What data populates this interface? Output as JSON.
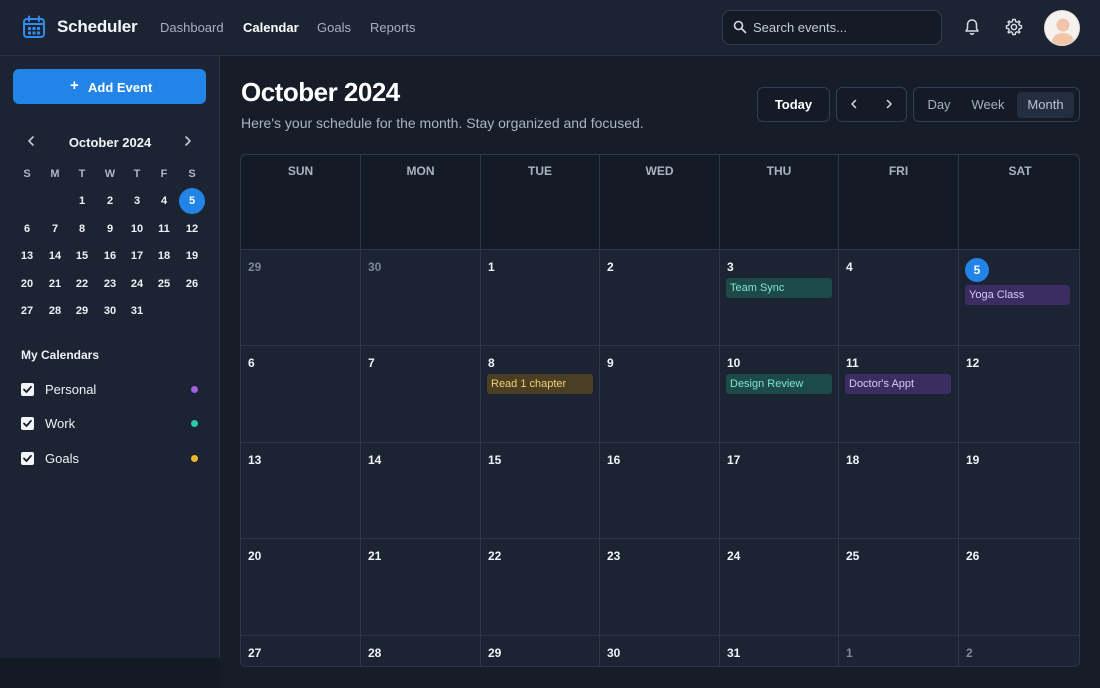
{
  "header": {
    "app_title": "Scheduler",
    "nav": [
      {
        "label": "Dashboard",
        "active": false
      },
      {
        "label": "Calendar",
        "active": true
      },
      {
        "label": "Goals",
        "active": false
      },
      {
        "label": "Reports",
        "active": false
      }
    ],
    "search_placeholder": "Search events...",
    "icons": [
      "calendar-icon",
      "search-icon",
      "bell-icon",
      "gear-icon",
      "avatar"
    ]
  },
  "sidebar": {
    "add_event_label": "Add Event",
    "mini_calendar": {
      "title": "October 2024",
      "weekdays": [
        "S",
        "M",
        "T",
        "W",
        "T",
        "F",
        "S"
      ],
      "weeks": [
        [
          "",
          "",
          "1",
          "2",
          "3",
          "4",
          "5"
        ],
        [
          "6",
          "7",
          "8",
          "9",
          "10",
          "11",
          "12"
        ],
        [
          "13",
          "14",
          "15",
          "16",
          "17",
          "18",
          "19"
        ],
        [
          "20",
          "21",
          "22",
          "23",
          "24",
          "25",
          "26"
        ],
        [
          "27",
          "28",
          "29",
          "30",
          "31",
          "",
          ""
        ]
      ],
      "today": "5"
    },
    "my_calendars_title": "My Calendars",
    "calendars": [
      {
        "label": "Personal",
        "checked": true,
        "color": "#a060e0"
      },
      {
        "label": "Work",
        "checked": true,
        "color": "#2cc9a8"
      },
      {
        "label": "Goals",
        "checked": true,
        "color": "#f0b429"
      }
    ]
  },
  "main": {
    "title": "October 2024",
    "subtitle": "Here's your schedule for the month. Stay organized and focused.",
    "today_label": "Today",
    "views": [
      {
        "label": "Day",
        "active": false
      },
      {
        "label": "Week",
        "active": false
      },
      {
        "label": "Month",
        "active": true
      }
    ],
    "weekdays": [
      "SUN",
      "MON",
      "TUE",
      "WED",
      "THU",
      "FRI",
      "SAT"
    ],
    "weeks": [
      [
        {
          "day": "29",
          "other": true
        },
        {
          "day": "30",
          "other": true
        },
        {
          "day": "1"
        },
        {
          "day": "2"
        },
        {
          "day": "3",
          "event": {
            "label": "Team Sync",
            "type": "work"
          }
        },
        {
          "day": "4"
        },
        {
          "day": "5",
          "today": true,
          "event": {
            "label": "Yoga Class",
            "type": "personal"
          }
        }
      ],
      [
        {
          "day": "6"
        },
        {
          "day": "7"
        },
        {
          "day": "8",
          "event": {
            "label": "Read 1 chapter",
            "type": "goal"
          }
        },
        {
          "day": "9"
        },
        {
          "day": "10",
          "event": {
            "label": "Design Review",
            "type": "work"
          }
        },
        {
          "day": "11",
          "event": {
            "label": "Doctor's Appt",
            "type": "personal"
          }
        },
        {
          "day": "12"
        }
      ],
      [
        {
          "day": "13"
        },
        {
          "day": "14"
        },
        {
          "day": "15"
        },
        {
          "day": "16"
        },
        {
          "day": "17"
        },
        {
          "day": "18"
        },
        {
          "day": "19"
        }
      ],
      [
        {
          "day": "20"
        },
        {
          "day": "21"
        },
        {
          "day": "22"
        },
        {
          "day": "23"
        },
        {
          "day": "24"
        },
        {
          "day": "25"
        },
        {
          "day": "26"
        }
      ],
      [
        {
          "day": "27"
        },
        {
          "day": "28"
        },
        {
          "day": "29"
        },
        {
          "day": "30"
        },
        {
          "day": "31"
        },
        {
          "day": "1",
          "other": true
        },
        {
          "day": "2",
          "other": true
        }
      ]
    ],
    "event_colors": {
      "work": {
        "bg": "#1d4a48",
        "fg": "#7ee6d0"
      },
      "personal": {
        "bg": "#3b2d62",
        "fg": "#d9c6ff"
      },
      "goal": {
        "bg": "#4a3e24",
        "fg": "#f5cf6e"
      }
    }
  }
}
